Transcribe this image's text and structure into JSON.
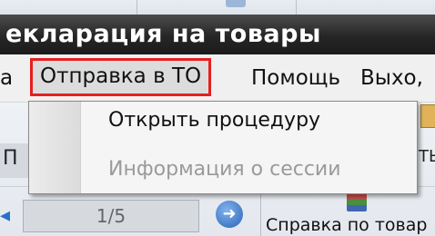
{
  "window": {
    "title": "екларация на товары"
  },
  "menubar": {
    "items": [
      {
        "label": "а"
      },
      {
        "label": "Отправка в ТО"
      },
      {
        "label": "Помощь"
      },
      {
        "label": "Выхо,"
      }
    ]
  },
  "dropdown": {
    "items": [
      {
        "label": "Открыть процедуру",
        "enabled": true
      },
      {
        "label": "Информация о сессии",
        "enabled": false
      }
    ]
  },
  "toolbar": {
    "left_label": "П",
    "right_label": "ТЫ",
    "pager_value": "1/5",
    "help_label": "Справка по товар"
  },
  "colors": {
    "title_bar": "#262626",
    "highlight_border": "#e61f1f",
    "disabled_text": "#9a9a9a"
  }
}
